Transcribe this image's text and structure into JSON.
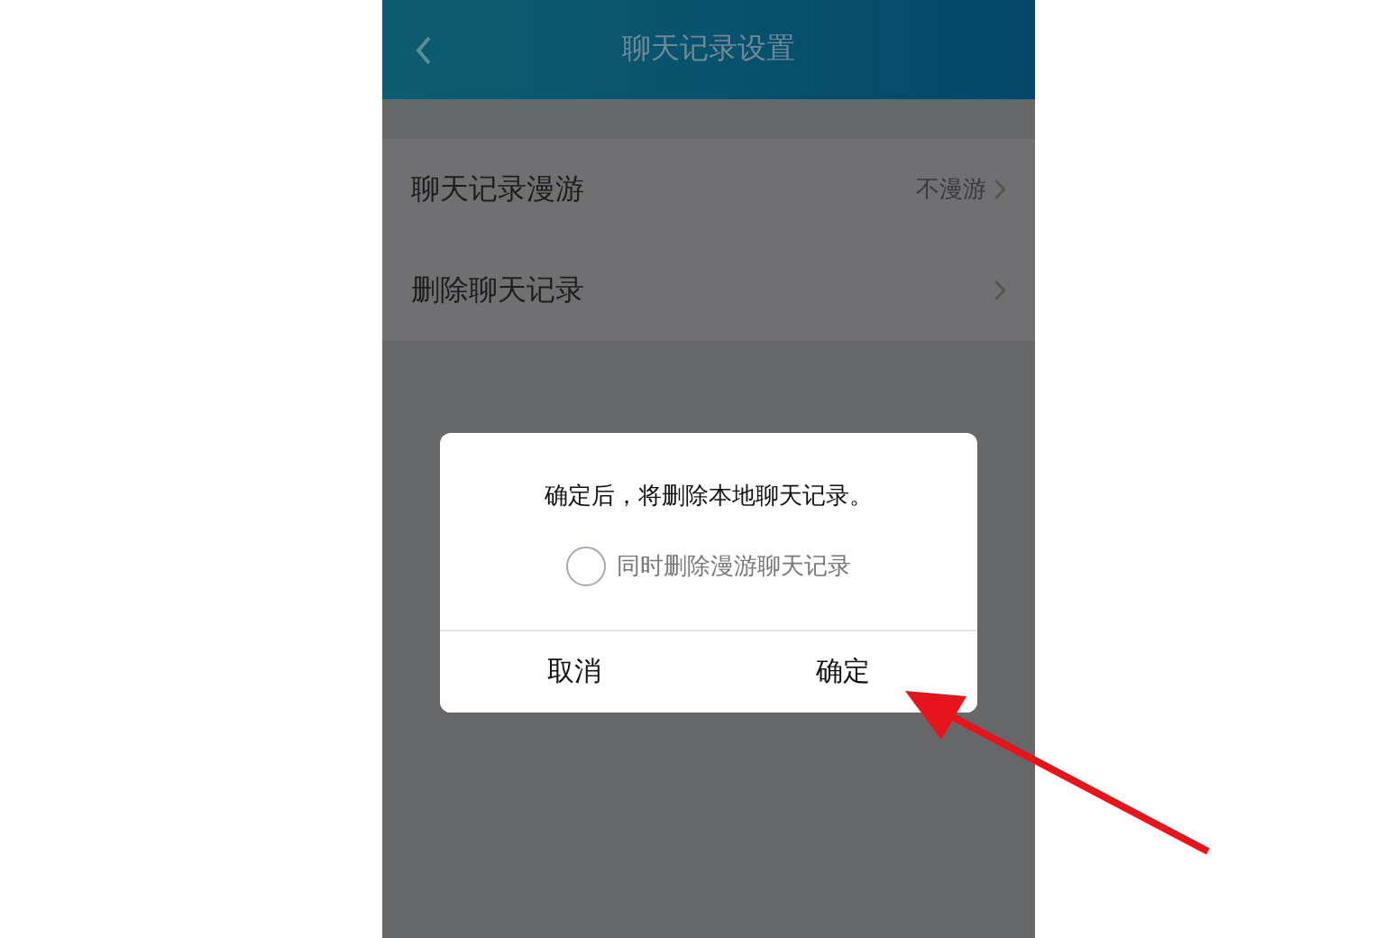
{
  "header": {
    "title": "聊天记录设置"
  },
  "settings": [
    {
      "label": "聊天记录漫游",
      "value": "不漫游"
    },
    {
      "label": "删除聊天记录"
    }
  ],
  "dialog": {
    "message": "确定后，将删除本地聊天记录。",
    "option": {
      "label": "同时删除漫游聊天记录",
      "checked": false
    },
    "buttons": [
      "取消",
      "确定"
    ]
  }
}
